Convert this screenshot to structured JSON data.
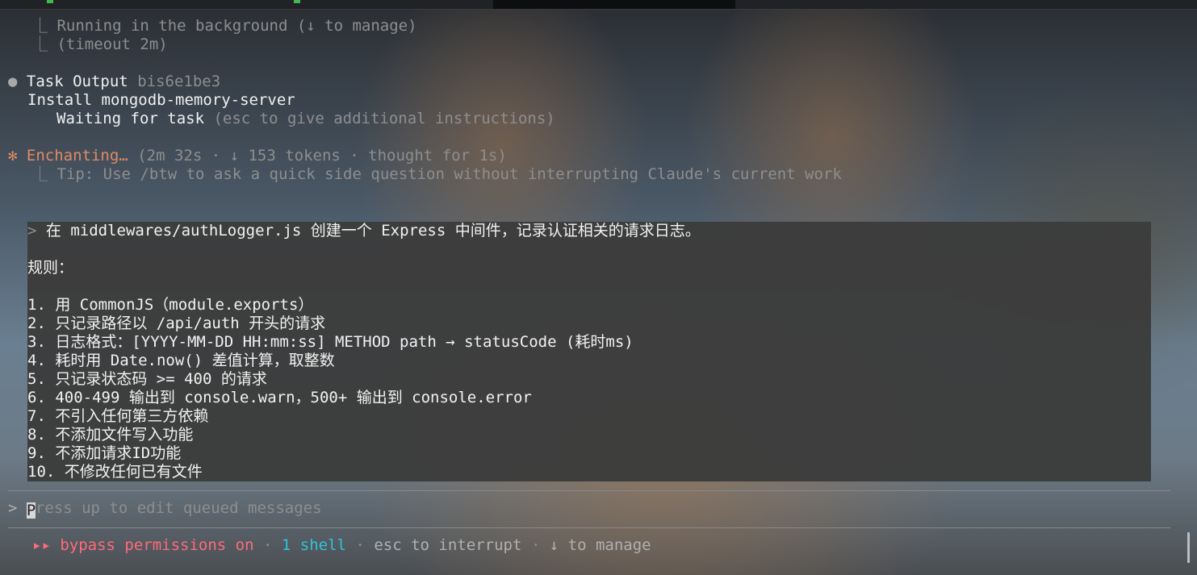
{
  "bg_task": {
    "line1": "⎿ Running in the background (↓ to manage)",
    "line2": "⎿ (timeout 2m)"
  },
  "task_output": {
    "label": "Task Output",
    "id": "bis6e1be3",
    "description": "Install mongodb-memory-server",
    "waiting": "Waiting for task",
    "hint": "(esc to give additional instructions)"
  },
  "status": {
    "glyph": "✻",
    "label": "Enchanting…",
    "meta": "(2m 32s · ↓ 153 tokens · thought for 1s)",
    "tip_prefix": "⎿ ",
    "tip": "Tip: Use /btw to ask a quick side question without interrupting Claude's current work"
  },
  "queued": {
    "prompt_mark": ">",
    "lines": [
      "在 middlewares/authLogger.js 创建一个 Express 中间件，记录认证相关的请求日志。",
      "",
      "规则：",
      "",
      "1. 用 CommonJS（module.exports）",
      "2. 只记录路径以 /api/auth 开头的请求",
      "3. 日志格式：[YYYY-MM-DD HH:mm:ss] METHOD path → statusCode (耗时ms)",
      "4. 耗时用 Date.now() 差值计算，取整数",
      "5. 只记录状态码 >= 400 的请求",
      "6. 400-499 输出到 console.warn，500+ 输出到 console.error",
      "7. 不引入任何第三方依赖",
      "8. 不添加文件写入功能",
      "9. 不添加请求ID功能",
      "10. 不修改任何已有文件"
    ]
  },
  "input": {
    "prompt": ">",
    "cursor_char": "P",
    "placeholder_rest": "ress up to edit queued messages"
  },
  "footer": {
    "arrows": "▸▸",
    "bypass": "bypass permissions on",
    "sep": "·",
    "shell": "1 shell",
    "interrupt": "esc to interrupt",
    "manage": "↓ to manage"
  },
  "colors": {
    "accent_orange": "#e08a64",
    "bypass_red": "#ff6b7a",
    "shell_cyan": "#2ec4d6",
    "queued_bg": "#3c3c3c"
  }
}
